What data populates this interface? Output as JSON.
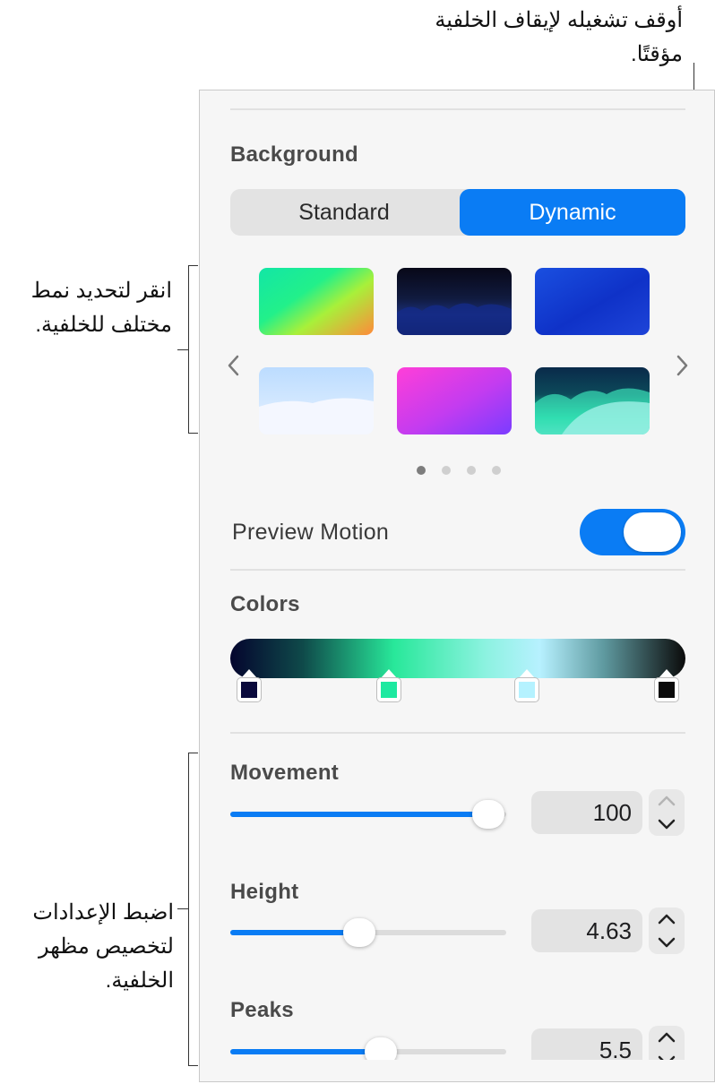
{
  "callouts": {
    "top": "أوقف تشغيله لإيقاف الخلفية مؤقتًا.",
    "middle": "انقر لتحديد نمط مختلف للخلفية.",
    "bottom": "اضبط الإعدادات لتخصيص مظهر الخلفية."
  },
  "background_section": {
    "title": "Background",
    "segments": {
      "standard": "Standard",
      "dynamic": "Dynamic",
      "selected": "Dynamic"
    },
    "page_index": 1,
    "page_count": 4,
    "prev_icon": "chevron-left-icon",
    "next_icon": "chevron-right-icon"
  },
  "preview_motion": {
    "label": "Preview Motion",
    "on": true
  },
  "colors_section": {
    "title": "Colors",
    "stops": [
      "#0a0a3c",
      "#1de9a0",
      "#b5f2ff",
      "#0b0b0b"
    ]
  },
  "movement": {
    "label": "Movement",
    "value": "100",
    "fraction": 1.0
  },
  "height": {
    "label": "Height",
    "value": "4.63",
    "fraction": 0.46
  },
  "peaks": {
    "label": "Peaks",
    "value": "5.5",
    "fraction": 0.55
  },
  "colors": {
    "accent": "#0a7cf4",
    "panel": "#f6f6f6"
  }
}
